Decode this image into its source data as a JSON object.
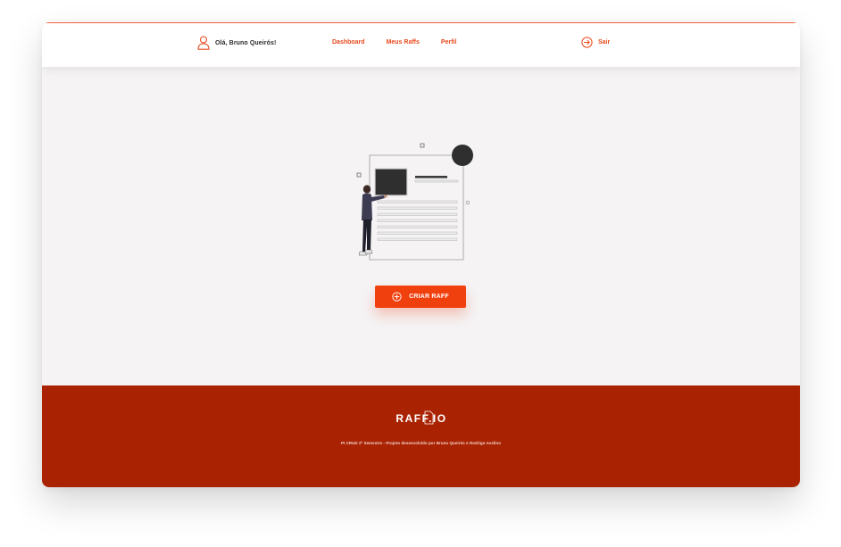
{
  "header": {
    "greeting": "Olá, Bruno Queirós!",
    "nav": [
      {
        "label": "Dashboard"
      },
      {
        "label": "Meus Raffs"
      },
      {
        "label": "Perfil"
      }
    ],
    "logout_label": "Sair"
  },
  "main": {
    "create_button_label": "CRIAR RAFF"
  },
  "footer": {
    "logo_text": "RAFF.IO",
    "credits": "PI CRUD 2º Semestre - Projeto desenvolvido por Bruno Queirós e Rodrigo Avelino"
  },
  "colors": {
    "accent": "#e8491d",
    "button": "#f0400d",
    "footer": "#a92303",
    "background": "#f5f3f4"
  },
  "icons": {
    "user": "user-icon",
    "logout": "logout-arrow-icon",
    "create": "plus-circle-icon"
  }
}
